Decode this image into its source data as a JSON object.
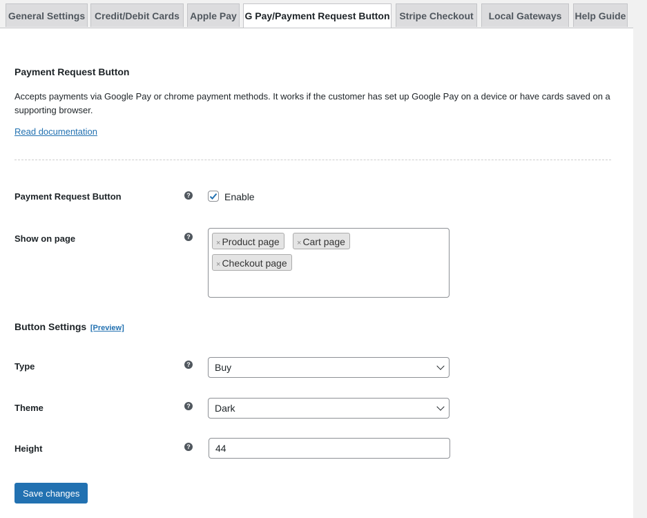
{
  "tabs": [
    {
      "label": "General Settings"
    },
    {
      "label": "Credit/Debit Cards"
    },
    {
      "label": "Apple Pay"
    },
    {
      "label": "G Pay/Payment Request Button",
      "active": true
    },
    {
      "label": "Stripe Checkout"
    },
    {
      "label": "Local Gateways"
    },
    {
      "label": "Help Guide"
    }
  ],
  "section": {
    "title": "Payment Request Button",
    "description": "Accepts payments via Google Pay or chrome payment methods. It works if the customer has set up Google Pay on a device or have cards saved on a supporting browser.",
    "doc_link": "Read documentation"
  },
  "fields": {
    "enable": {
      "label": "Payment Request Button",
      "checkbox_label": "Enable",
      "checked": true
    },
    "show_on_page": {
      "label": "Show on page",
      "selected": [
        "Product page",
        "Cart page",
        "Checkout page"
      ],
      "remove_glyph": "×"
    },
    "button_settings": {
      "title": "Button Settings",
      "preview_link": "[Preview]"
    },
    "type": {
      "label": "Type",
      "value": "Buy"
    },
    "theme": {
      "label": "Theme",
      "value": "Dark"
    },
    "height": {
      "label": "Height",
      "value": "44"
    }
  },
  "help_glyph": "?",
  "save_label": "Save changes",
  "colors": {
    "accent": "#2271b1"
  }
}
